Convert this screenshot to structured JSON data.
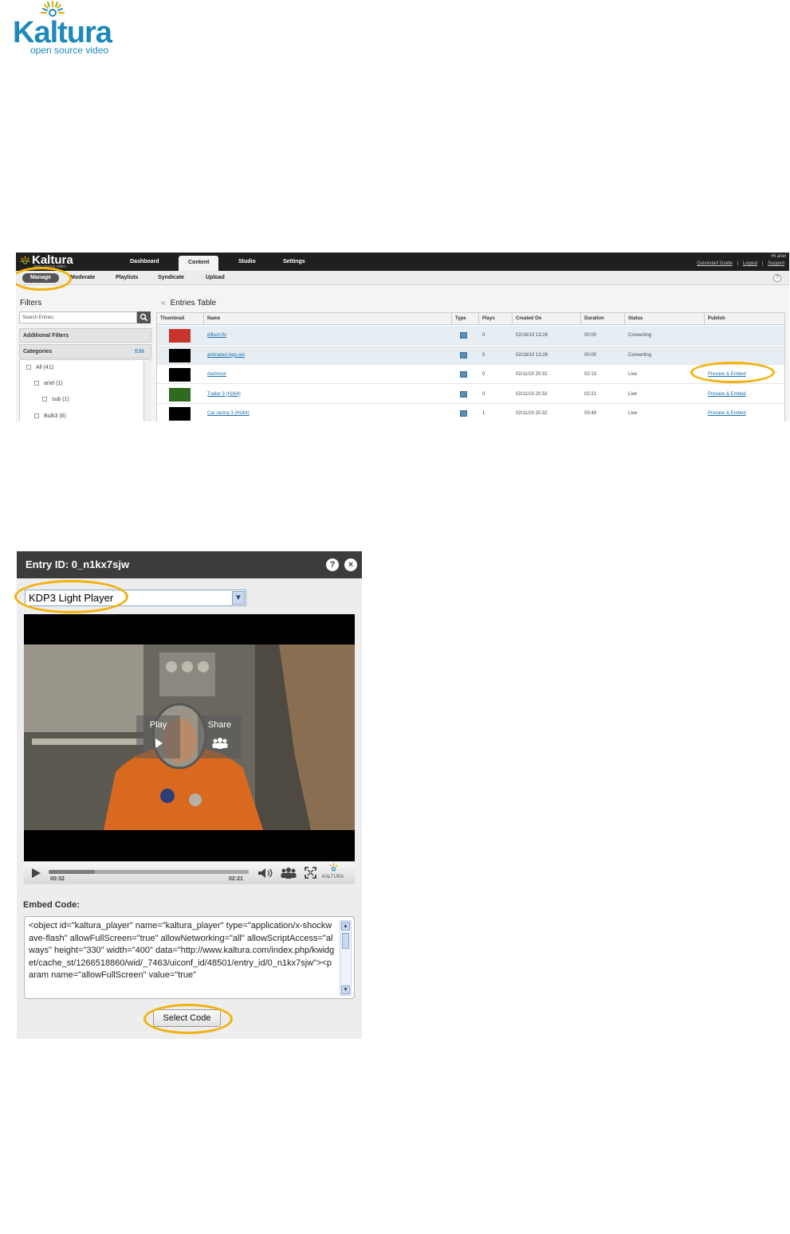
{
  "logo": {
    "word": "Kaltura",
    "tagline": "open source video"
  },
  "kmc": {
    "logo_word": "Kaltura",
    "logo_tagline": "open source video",
    "top_tabs": [
      "Dashboard",
      "Content",
      "Studio",
      "Settings"
    ],
    "active_top_tab": "Content",
    "top_links": {
      "guide": "Quickstart Guide",
      "sep1": "|",
      "logout": "Logout",
      "sep2": "|",
      "support": "Support"
    },
    "username": "Hi ariel",
    "sub_tabs": [
      "Manage",
      "Moderate",
      "Playlists",
      "Syndicate",
      "Upload"
    ],
    "active_sub_tab": "Manage",
    "help": "?",
    "filters_title": "Filters",
    "search_placeholder": "Search Entries",
    "additional_filters": "Additional Filters",
    "categories": "Categories",
    "edit": "Edit",
    "tree": [
      {
        "label": "All (41)"
      },
      {
        "label": "ariel (1)"
      },
      {
        "label": "sub (1)"
      },
      {
        "label": "Bulk3 (6)"
      }
    ],
    "entries_chevron": "«",
    "entries_title": "Entries Table",
    "columns": [
      "Thumbnail",
      "Name",
      "Type",
      "Plays",
      "Created On",
      "Duration",
      "Status",
      "Publish"
    ],
    "rows": [
      {
        "name": "dilbert.flv",
        "plays": "0",
        "created": "02/18/10 13:26",
        "duration": "00:00",
        "status": "Converting",
        "publish": "",
        "thumb": "#c8342c"
      },
      {
        "name": "animated logo.avi",
        "plays": "0",
        "created": "02/18/10 13:26",
        "duration": "00:00",
        "status": "Converting",
        "publish": "",
        "thumb": "#000000"
      },
      {
        "name": "dartmoor",
        "plays": "0",
        "created": "02/11/10 20:32",
        "duration": "02:13",
        "status": "Live",
        "publish": "Preview & Embed",
        "thumb": "#000000"
      },
      {
        "name": "Trailer 3 (H264)",
        "plays": "0",
        "created": "02/11/10 20:32",
        "duration": "02:21",
        "status": "Live",
        "publish": "Preview & Embed",
        "thumb": "#2e6b1f"
      },
      {
        "name": "Car racing 3 (H264)",
        "plays": "1",
        "created": "02/11/10 20:32",
        "duration": "03:49",
        "status": "Live",
        "publish": "Preview & Embed",
        "thumb": "#000000"
      }
    ]
  },
  "dialog": {
    "title": "Entry ID: 0_n1kx7sjw",
    "help": "?",
    "close": "×",
    "player_select": "KDP3 Light Player",
    "overlay_play": "Play",
    "overlay_share": "Share",
    "time_current": "00:32",
    "time_total": "02:21",
    "progress": 0.23,
    "brand": "KALTURA",
    "embed_label": "Embed Code:",
    "embed_code": "<object id=\"kaltura_player\" name=\"kaltura_player\" type=\"application/x-shockwave-flash\" allowFullScreen=\"true\" allowNetworking=\"all\" allowScriptAccess=\"always\" height=\"330\" width=\"400\" data=\"http://www.kaltura.com/index.php/kwidget/cache_st/1266518860/wid/_7463/uiconf_id/48501/entry_id/0_n1kx7sjw\"><param name=\"allowFullScreen\" value=\"true\"",
    "select_code": "Select Code"
  },
  "colors": {
    "highlight": "#f3b20b",
    "brand_blue": "#1c89b8",
    "link": "#1a6fb0"
  }
}
